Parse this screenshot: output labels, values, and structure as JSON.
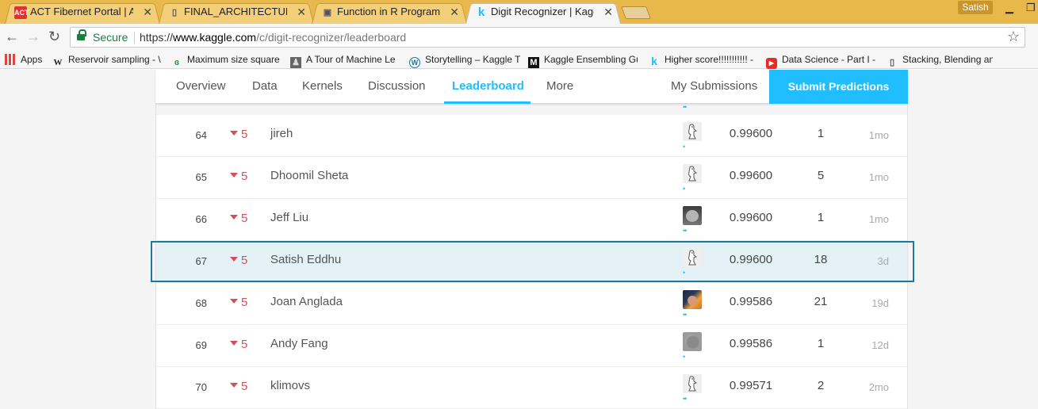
{
  "browser": {
    "tabs": [
      {
        "title": "ACT Fibernet Portal | ACT",
        "favicon": "act-logo-icon",
        "active": false
      },
      {
        "title": "FINAL_ARCHITECTURE.pr",
        "favicon": "document-icon",
        "active": false
      },
      {
        "title": "Function in R Programmi",
        "favicon": "gift-icon",
        "active": false
      },
      {
        "title": "Digit Recognizer | Kaggle",
        "favicon": "kaggle-icon",
        "active": true
      }
    ],
    "user": "Satish",
    "secure_label": "Secure",
    "url_scheme": "https://",
    "url_host": "www.kaggle.com",
    "url_path": "/c/digit-recognizer/leaderboard",
    "bookmarks": [
      {
        "label": "Apps",
        "icon": "apps-grid-icon"
      },
      {
        "label": "Reservoir sampling - \\",
        "icon": "wikipedia-icon"
      },
      {
        "label": "Maximum size square",
        "icon": "geeks-icon"
      },
      {
        "label": "A Tour of Machine Le",
        "icon": "person-icon"
      },
      {
        "label": "Storytelling – Kaggle T",
        "icon": "wordpress-icon"
      },
      {
        "label": "Kaggle Ensembling Gu",
        "icon": "mlwave-icon"
      },
      {
        "label": "Higher score!!!!!!!!!!! -",
        "icon": "kaggle-icon"
      },
      {
        "label": "Data Science - Part I -",
        "icon": "youtube-icon"
      },
      {
        "label": "Stacking, Blending an",
        "icon": "document-icon"
      }
    ]
  },
  "subnav": {
    "items": [
      "Overview",
      "Data",
      "Kernels",
      "Discussion",
      "Leaderboard",
      "More"
    ],
    "active": "Leaderboard",
    "my_submissions": "My Submissions",
    "submit_label": "Submit Predictions"
  },
  "leaderboard": {
    "rows": [
      {
        "rank": "64",
        "change": "5",
        "team": "jireh",
        "avatar": "default",
        "tier_dots": "•",
        "score": "0.99600",
        "entries": "1",
        "last": "1mo"
      },
      {
        "rank": "65",
        "change": "5",
        "team": "Dhoomil Sheta",
        "avatar": "default",
        "tier_dots": "•",
        "score": "0.99600",
        "entries": "5",
        "last": "1mo"
      },
      {
        "rank": "66",
        "change": "5",
        "team": "Jeff Liu",
        "avatar": "cat",
        "tier_dots": "••",
        "score": "0.99600",
        "entries": "1",
        "last": "1mo"
      },
      {
        "rank": "67",
        "change": "5",
        "team": "Satish Eddhu",
        "avatar": "default",
        "tier_dots": "•",
        "score": "0.99600",
        "entries": "18",
        "last": "3d",
        "highlight": true
      },
      {
        "rank": "68",
        "change": "5",
        "team": "Joan Anglada",
        "avatar": "photo",
        "tier_dots": "••",
        "score": "0.99586",
        "entries": "21",
        "last": "19d"
      },
      {
        "rank": "69",
        "change": "5",
        "team": "Andy Fang",
        "avatar": "grey",
        "tier_dots": "•",
        "score": "0.99586",
        "entries": "1",
        "last": "12d"
      },
      {
        "rank": "70",
        "change": "5",
        "team": "klimovs",
        "avatar": "default",
        "tier_dots": "••",
        "score": "0.99571",
        "entries": "2",
        "last": "2mo"
      }
    ]
  },
  "colors": {
    "accent": "#20beff",
    "rank_drop": "#d2505a",
    "highlight_row": "#e4f2f7",
    "highlight_border": "#1a7a9a"
  }
}
